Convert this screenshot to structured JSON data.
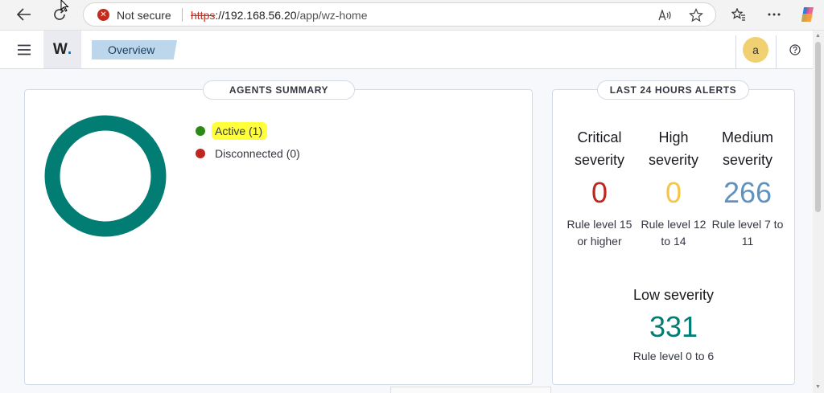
{
  "browser": {
    "security_label": "Not secure",
    "url_protocol": "https",
    "url_host": "://192.168.56.20",
    "url_path": "/app/wz-home",
    "icons": [
      "back-icon",
      "refresh-icon",
      "read-aloud-icon",
      "favorite-star-icon",
      "favorites-icon",
      "more-icon",
      "copilot-icon"
    ]
  },
  "header": {
    "logo_letter": "W",
    "logo_dot": ".",
    "breadcrumb": "Overview",
    "avatar_letter": "a",
    "help_icon": "help-icon",
    "menu_icon": "hamburger-icon"
  },
  "agents": {
    "title": "AGENTS SUMMARY",
    "donut_color": "#017d73",
    "items": [
      {
        "label": "Active (1)",
        "color": "#2a8a14"
      },
      {
        "label": "Disconnected (0)",
        "color": "#bd271e"
      }
    ]
  },
  "alerts": {
    "title": "LAST 24 HOURS ALERTS",
    "severities": [
      {
        "name": "Critical severity",
        "count": "0",
        "color": "#bd271e",
        "rule": "Rule level 15 or higher"
      },
      {
        "name": "High severity",
        "count": "0",
        "color": "#f5c543",
        "rule": "Rule level 12 to 14"
      },
      {
        "name": "Medium severity",
        "count": "266",
        "color": "#6092c0",
        "rule": "Rule level 7 to 11"
      },
      {
        "name": "Low severity",
        "count": "331",
        "color": "#017d73",
        "rule": "Rule level 0 to 6"
      }
    ]
  }
}
